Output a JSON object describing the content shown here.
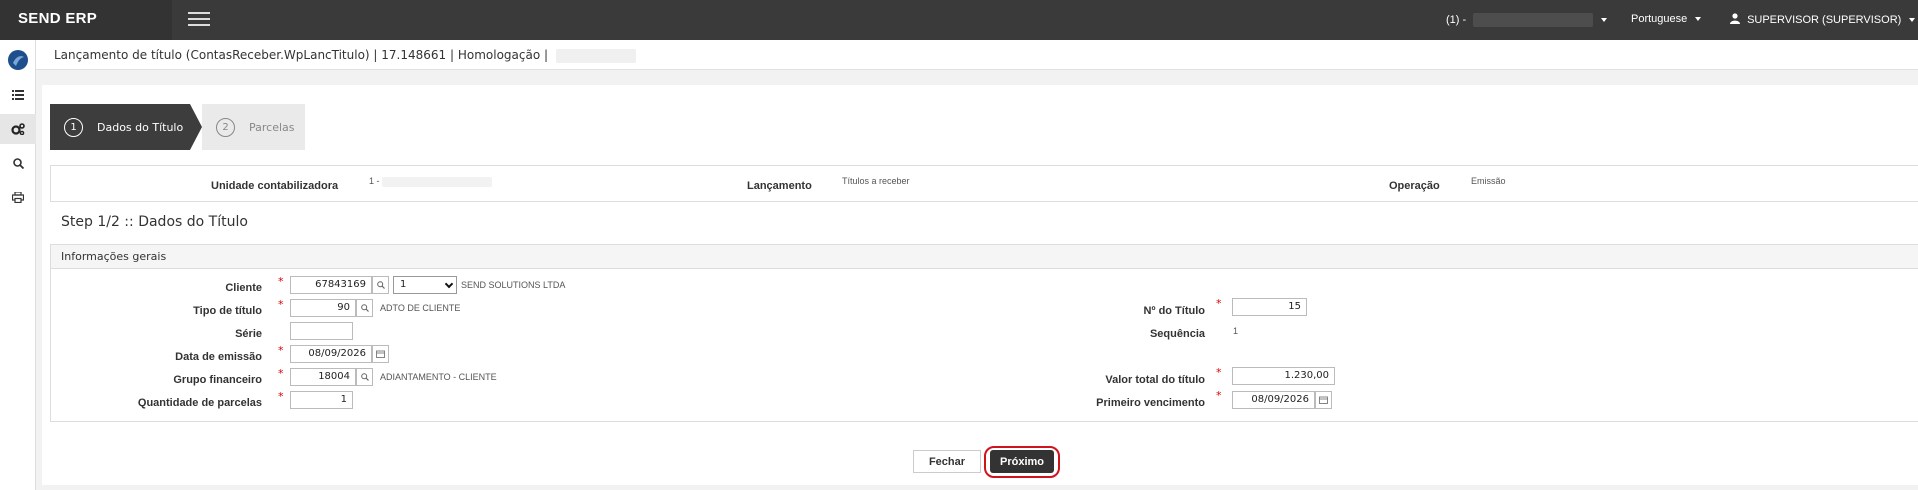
{
  "topbar": {
    "brand": "SEND ERP",
    "company_prefix": "(1) -",
    "language": "Portuguese",
    "user": "SUPERVISOR (SUPERVISOR)"
  },
  "breadcrumb": {
    "text": "Lançamento de título (ContasReceber.WpLancTitulo) | 17.148661 | Homologação |"
  },
  "wizard": {
    "steps": [
      {
        "number": "1",
        "label": "Dados do Título"
      },
      {
        "number": "2",
        "label": "Parcelas"
      }
    ]
  },
  "summary": {
    "unidade_label": "Unidade contabilizadora",
    "unidade_value": "1 -",
    "lancamento_label": "Lançamento",
    "lancamento_value": "Títulos a receber",
    "operacao_label": "Operação",
    "operacao_value": "Emissão"
  },
  "step_title": "Step 1/2 :: Dados do Título",
  "panel": {
    "title": "Informações gerais",
    "cliente_label": "Cliente",
    "cliente_code": "67843169",
    "cliente_select": "1",
    "cliente_desc": "SEND SOLUTIONS LTDA",
    "tipo_label": "Tipo de título",
    "tipo_code": "90",
    "tipo_desc": "ADTO DE CLIENTE",
    "serie_label": "Série",
    "serie_value": "",
    "data_emissao_label": "Data de emissão",
    "data_emissao_value": "08/09/2026",
    "grupo_label": "Grupo financeiro",
    "grupo_code": "18004",
    "grupo_desc": "ADIANTAMENTO - CLIENTE",
    "qtd_label": "Quantidade de parcelas",
    "qtd_value": "1",
    "num_titulo_label": "Nº do Título",
    "num_titulo_value": "15",
    "sequencia_label": "Sequência",
    "sequencia_value": "1",
    "valor_label": "Valor total do título",
    "valor_value": "1.230,00",
    "venc_label": "Primeiro vencimento",
    "venc_value": "08/09/2026"
  },
  "actions": {
    "fechar": "Fechar",
    "proximo": "Próximo"
  },
  "required_mark": "*"
}
